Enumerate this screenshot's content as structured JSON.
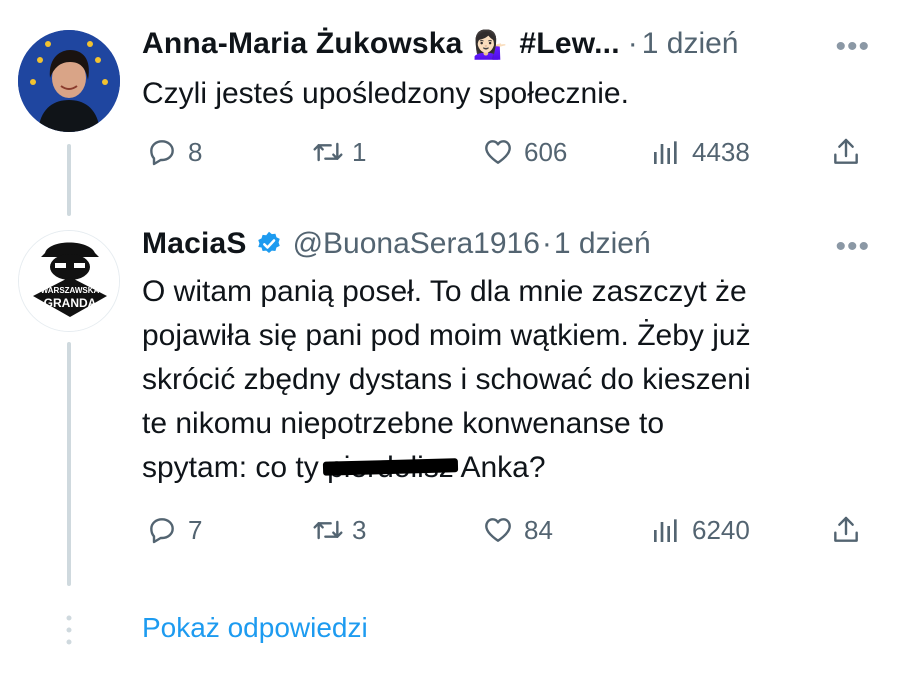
{
  "tweets": [
    {
      "name": "Anna-Maria Żukowska",
      "emoji": "💁🏻‍♀️",
      "hashtag": "#Lew...",
      "handle": "",
      "time": "1 dzień",
      "text": "Czyli jesteś upośledzony społecznie.",
      "replies": "8",
      "retweets": "1",
      "likes": "606",
      "views": "4438"
    },
    {
      "name": "MaciaS",
      "handle": "@BuonaSera1916",
      "time": "1 dzień",
      "text_lines": [
        "O witam panią poseł. To dla mnie zaszczyt że",
        "pojawiła się pani pod moim wątkiem. Żeby już",
        "skrócić zbędny dystans i schować do kieszeni",
        "te nikomu niepotrzebne konwenanse to"
      ],
      "text_last_prefix": "spytam: co ty ",
      "text_redacted": "pierdolisz",
      "text_last_suffix": " Anka?",
      "avatar_text_top": "WARSZAWSKA",
      "avatar_text_bottom": "GRANDA",
      "replies": "7",
      "retweets": "3",
      "likes": "84",
      "views": "6240"
    }
  ],
  "show_replies": "Pokaż odpowiedzi",
  "colors": {
    "accent": "#1d9bf0",
    "muted": "#536471",
    "line": "#cfd9de"
  }
}
